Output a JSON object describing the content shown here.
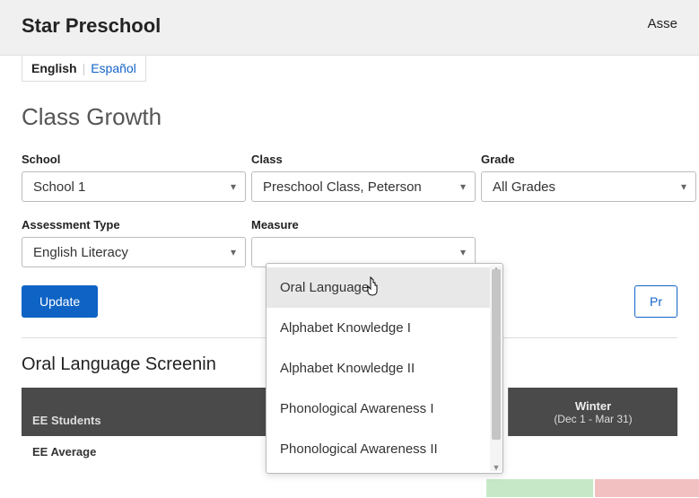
{
  "header": {
    "title": "Star Preschool",
    "right_partial": "Asse"
  },
  "lang": {
    "english": "English",
    "spanish": "Español"
  },
  "page": {
    "title": "Class Growth"
  },
  "filters": {
    "school": {
      "label": "School",
      "value": "School 1"
    },
    "class": {
      "label": "Class",
      "value": "Preschool Class, Peterson"
    },
    "grade": {
      "label": "Grade",
      "value": "All Grades"
    },
    "assessment_type": {
      "label": "Assessment Type",
      "value": "English Literacy"
    },
    "measure": {
      "label": "Measure",
      "value": ""
    }
  },
  "buttons": {
    "update": "Update",
    "right_partial": "Pr"
  },
  "section": {
    "title_partial": "Oral Language Screenin"
  },
  "table": {
    "col_students": "EE Students",
    "winter_title": "Winter",
    "winter_range": "(Dec 1 - Mar 31)",
    "row_avg_partial": "EE Average"
  },
  "measure_dropdown": {
    "items": [
      "Oral Language",
      "Alphabet Knowledge I",
      "Alphabet Knowledge II",
      "Phonological Awareness I",
      "Phonological Awareness II"
    ]
  }
}
